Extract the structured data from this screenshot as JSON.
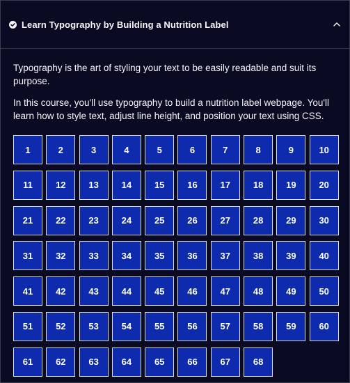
{
  "header": {
    "title": "Learn Typography by Building a Nutrition Label",
    "status_icon": "check-circle-icon",
    "toggle_icon": "chevron-up-icon"
  },
  "intro": {
    "paragraph1": "Typography is the art of styling your text to be easily readable and suit its purpose.",
    "paragraph2": "In this course, you'll use typography to build a nutrition label webpage. You'll learn how to style text, adjust line height, and position your text using CSS."
  },
  "steps": [
    "1",
    "2",
    "3",
    "4",
    "5",
    "6",
    "7",
    "8",
    "9",
    "10",
    "11",
    "12",
    "13",
    "14",
    "15",
    "16",
    "17",
    "18",
    "19",
    "20",
    "21",
    "22",
    "23",
    "24",
    "25",
    "26",
    "27",
    "28",
    "29",
    "30",
    "31",
    "32",
    "33",
    "34",
    "35",
    "36",
    "37",
    "38",
    "39",
    "40",
    "41",
    "42",
    "43",
    "44",
    "45",
    "46",
    "47",
    "48",
    "49",
    "50",
    "51",
    "52",
    "53",
    "54",
    "55",
    "56",
    "57",
    "58",
    "59",
    "60",
    "61",
    "62",
    "63",
    "64",
    "65",
    "66",
    "67",
    "68"
  ],
  "colors": {
    "background": "#0a0a23",
    "border": "#3b3b4f",
    "step_fill": "#0d2bac",
    "step_border": "#dfdfe2",
    "text": "#f5f6f7"
  }
}
